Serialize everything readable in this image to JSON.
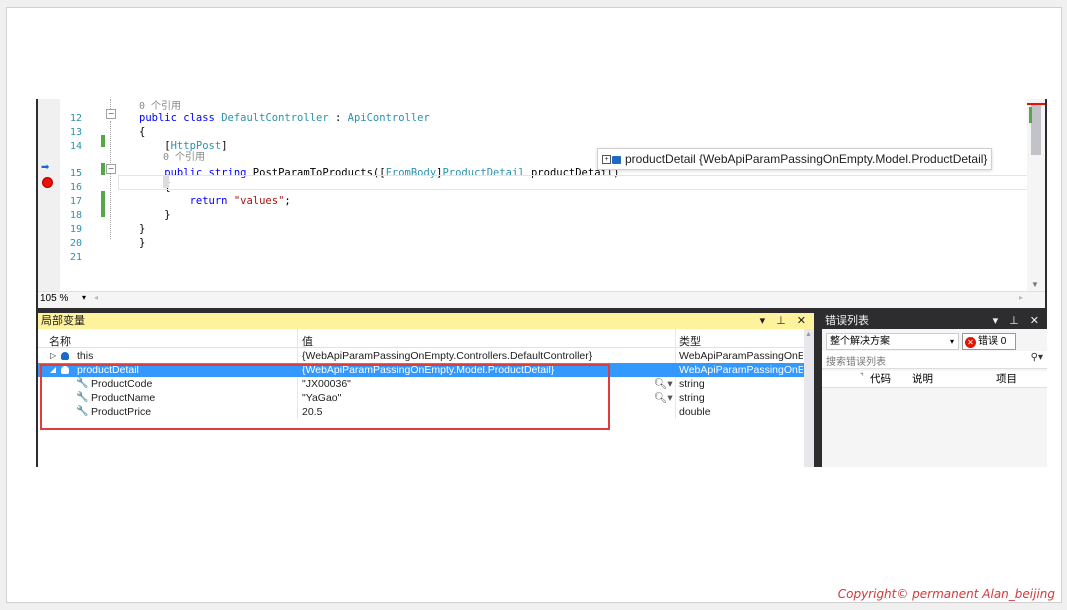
{
  "editor": {
    "ref_top": "0 个引用",
    "lines": [
      {
        "num": "12",
        "parts": [
          {
            "t": "public class ",
            "c": "kw"
          },
          {
            "t": "DefaultController",
            "c": "ty"
          },
          {
            "t": " : ",
            "c": ""
          },
          {
            "t": "ApiController",
            "c": "ty"
          }
        ]
      },
      {
        "num": "13",
        "parts": [
          {
            "t": "{",
            "c": ""
          }
        ]
      },
      {
        "num": "14",
        "parts": [
          {
            "t": "    [",
            "c": ""
          },
          {
            "t": "HttpPost",
            "c": "ty"
          },
          {
            "t": "]",
            "c": ""
          }
        ]
      },
      {
        "num": "15",
        "parts": [
          {
            "t": "    public string ",
            "c": "kw"
          },
          {
            "t": "PostParamToProducts([",
            "c": ""
          },
          {
            "t": "FromBody",
            "c": "ty"
          },
          {
            "t": "]",
            "c": ""
          },
          {
            "t": "ProductDetail",
            "c": "ty"
          },
          {
            "t": " productDetail)",
            "c": ""
          }
        ]
      },
      {
        "num": "16",
        "parts": [
          {
            "t": "    {",
            "c": ""
          }
        ]
      },
      {
        "num": "17",
        "parts": [
          {
            "t": "        return ",
            "c": "kw"
          },
          {
            "t": "\"values\"",
            "c": "str"
          },
          {
            "t": ";",
            "c": ""
          }
        ]
      },
      {
        "num": "18",
        "parts": [
          {
            "t": "    }",
            "c": ""
          }
        ]
      },
      {
        "num": "19",
        "parts": [
          {
            "t": "}",
            "c": ""
          }
        ]
      },
      {
        "num": "20",
        "parts": [
          {
            "t": "}",
            "c": ""
          }
        ]
      },
      {
        "num": "21",
        "parts": []
      }
    ],
    "ref_mid": "0 个引用",
    "zoom": "105 %",
    "datatip": "productDetail {WebApiParamPassingOnEmpty.Model.ProductDetail}"
  },
  "locals": {
    "title": "局部变量",
    "controls": "▾ ⊥ ✕",
    "col_name": "名称",
    "col_value": "值",
    "col_type": "类型",
    "rows": [
      {
        "name": "this",
        "value": "{WebApiParamPassingOnEmpty.Controllers.DefaultController}",
        "type": "WebApiParamPassingOnEm"
      },
      {
        "name": "productDetail",
        "value": "{WebApiParamPassingOnEmpty.Model.ProductDetail}",
        "type": "WebApiParamPassingOnEm"
      },
      {
        "name": "ProductCode",
        "value": "\"JX00036\"",
        "type": "string"
      },
      {
        "name": "ProductName",
        "value": "\"YaGao\"",
        "type": "string"
      },
      {
        "name": "ProductPrice",
        "value": "20.5",
        "type": "double"
      }
    ]
  },
  "errors": {
    "title": "错误列表",
    "controls": "▾ ⊥ ✕",
    "scope": "整个解决方案",
    "error_btn": "错误 0",
    "search_placeholder": "搜索错误列表",
    "col_code": "代码",
    "col_desc": "说明",
    "col_project": "项目"
  },
  "copyright": "Copyright© permanent  Alan_beijing"
}
